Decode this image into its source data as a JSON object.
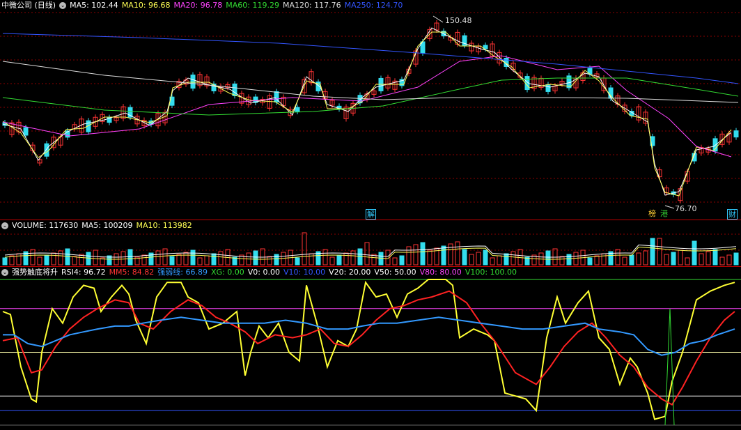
{
  "price_panel": {
    "title": "中微公司 (日线)",
    "indicators": [
      {
        "label": "MA5: 102.44",
        "color": "#ffffff"
      },
      {
        "label": "MA10: 96.68",
        "color": "#ffff55"
      },
      {
        "label": "MA20: 96.78",
        "color": "#ff44ff"
      },
      {
        "label": "MA60: 119.29",
        "color": "#33dd33"
      },
      {
        "label": "MA120: 117.76",
        "color": "#dddddd"
      },
      {
        "label": "MA250: 124.70",
        "color": "#3355ff"
      }
    ],
    "high_label": "150.48",
    "low_label": "76.70",
    "event_markers": [
      {
        "text": "解",
        "color": "#33ccff"
      },
      {
        "text": "榜",
        "color": "#ffcc33"
      },
      {
        "text": "港",
        "color": "#33cc33"
      },
      {
        "text": "财",
        "color": "#33ccff"
      }
    ]
  },
  "volume_panel": {
    "indicators": [
      {
        "label": "VOLUME: 117630",
        "color": "#ffffff"
      },
      {
        "label": "MA5: 100209",
        "color": "#ffffff"
      },
      {
        "label": "MA10: 113982",
        "color": "#ffff55"
      }
    ]
  },
  "rsi_panel": {
    "title": "强势触底将升",
    "indicators": [
      {
        "label": "RSI4: 96.72",
        "color": "#ffffff"
      },
      {
        "label": "MM5: 84.82",
        "color": "#ff3333"
      },
      {
        "label": "强弱线: 66.89",
        "color": "#3399ff"
      },
      {
        "label": "XG: 0.00",
        "color": "#33dd33"
      },
      {
        "label": "V0: 0.00",
        "color": "#ffffff"
      },
      {
        "label": "V10: 10.00",
        "color": "#3355ff"
      },
      {
        "label": "V20: 20.00",
        "color": "#ffffff"
      },
      {
        "label": "V50: 50.00",
        "color": "#ffffff"
      },
      {
        "label": "V80: 80.00",
        "color": "#ff44ff"
      },
      {
        "label": "V100: 100.00",
        "color": "#33dd33"
      }
    ]
  },
  "colors": {
    "up": "#ff3333",
    "down": "#33ddee",
    "grid": "#8b0000",
    "separator": "#c00000"
  }
}
